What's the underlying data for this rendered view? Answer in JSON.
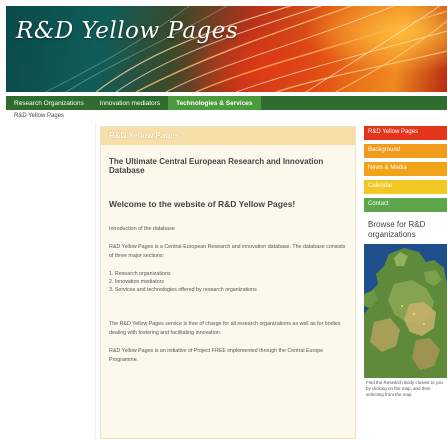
{
  "banner": {
    "title": "R&D Yellow Pages",
    "corner_text": "..."
  },
  "nav": {
    "items": [
      {
        "label": "Research Organizations"
      },
      {
        "label": "Innovation mediators"
      },
      {
        "label": "Technologies & Services"
      }
    ]
  },
  "breadcrumb": "R&D Yellow Pages",
  "main": {
    "header": "R&D Yellow Pages",
    "subtitle": "The Ultimate Central European Research and Innovation Database",
    "welcome": "Welcome to the website of R&D Yellow Pages!",
    "intro_heading": "Introduction of the database",
    "intro_text": "R&D Yellow Pages is a Central-European Research and innovation database. The database consists of three major sections:",
    "sections": [
      "1. Research organizations",
      "2. Innovation mediators",
      "3. Services and technologies offered by research organizations"
    ],
    "free_text": "The R&D Yellow Pages service is free of charge for all research organizations as well as for bodies dealing with fostering and facilitating innovation.",
    "initiative_text": "R&D Yellow Pages is an initiative of Project FREE implemented through the Central Europe Programme."
  },
  "sidebar": {
    "menu": [
      {
        "label": "R&D Yellow Pages",
        "color": "#e4351c"
      },
      {
        "label": "Background",
        "color": "#f29a19"
      },
      {
        "label": "News & Media",
        "color": "#f2a219"
      },
      {
        "label": "Calendar",
        "color": "#f3c724"
      },
      {
        "label": "Contact",
        "color": "#5da64c"
      }
    ],
    "browse_title": "Browse for R&D organizations",
    "map_caption": "Find the Research Body closest to you by clicking on the map, and then selecting from the map"
  },
  "colors": {
    "nav_bg": "#2f6d2f",
    "nav_active": "#4b9a3c",
    "main_header": "#f6dfa8",
    "main_bg": "#fdf8ec"
  }
}
